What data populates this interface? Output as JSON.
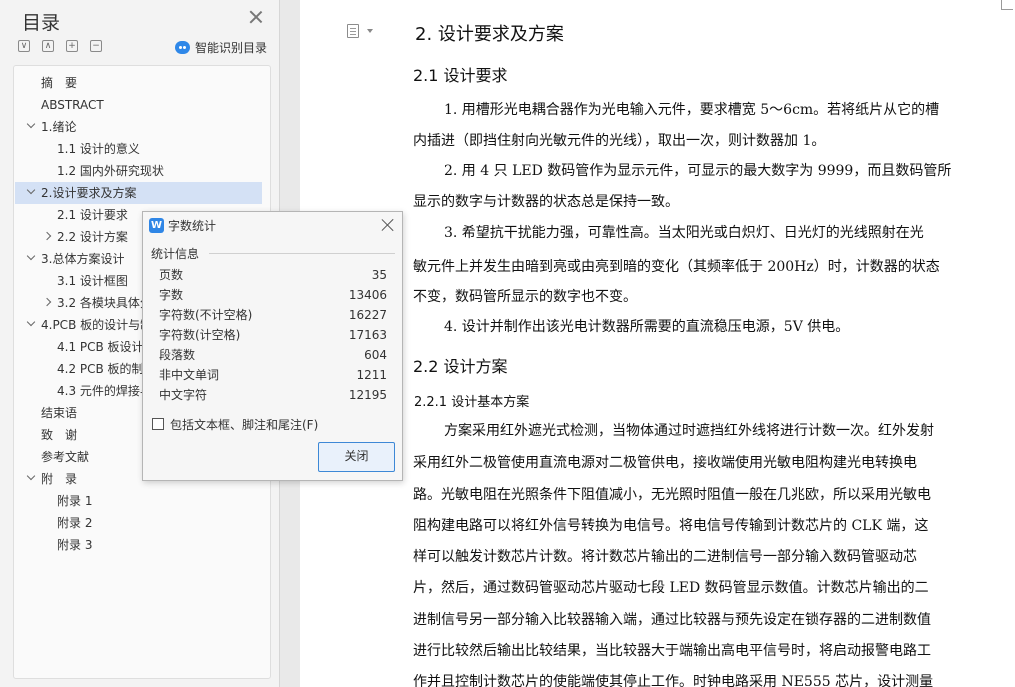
{
  "nav": {
    "title": "目录",
    "smart_toc_label": "智能识别目录",
    "items": [
      {
        "label": "摘　要",
        "level": 1,
        "caret": "none",
        "selected": false
      },
      {
        "label": "ABSTRACT",
        "level": 1,
        "caret": "none",
        "selected": false
      },
      {
        "label": "1.绪论",
        "level": 1,
        "caret": "down",
        "selected": false
      },
      {
        "label": "1.1 设计的意义",
        "level": 2,
        "caret": "none",
        "selected": false
      },
      {
        "label": "1.2 国内外研究现状",
        "level": 2,
        "caret": "none",
        "selected": false
      },
      {
        "label": "2.设计要求及方案",
        "level": 1,
        "caret": "down",
        "selected": true
      },
      {
        "label": "2.1 设计要求",
        "level": 2,
        "caret": "none",
        "selected": false
      },
      {
        "label": "2.2 设计方案",
        "level": 2,
        "caret": "right",
        "selected": false
      },
      {
        "label": "3.总体方案设计",
        "level": 1,
        "caret": "down",
        "selected": false
      },
      {
        "label": "3.1 设计框图",
        "level": 2,
        "caret": "none",
        "selected": false
      },
      {
        "label": "3.2 各模块具体分析",
        "level": 2,
        "caret": "right",
        "selected": false
      },
      {
        "label": "4.PCB 板的设计与制作",
        "level": 1,
        "caret": "down",
        "selected": false
      },
      {
        "label": "4.1 PCB 板设计",
        "level": 2,
        "caret": "none",
        "selected": false
      },
      {
        "label": "4.2 PCB 板的制作",
        "level": 2,
        "caret": "none",
        "selected": false
      },
      {
        "label": "4.3 元件的焊接与调试",
        "level": 2,
        "caret": "none",
        "selected": false
      },
      {
        "label": "结束语",
        "level": 1,
        "caret": "none",
        "selected": false
      },
      {
        "label": "致　谢",
        "level": 1,
        "caret": "none",
        "selected": false
      },
      {
        "label": "参考文献",
        "level": 1,
        "caret": "none",
        "selected": false
      },
      {
        "label": "附　录",
        "level": 1,
        "caret": "down",
        "selected": false
      },
      {
        "label": "附录 1",
        "level": 2,
        "caret": "none",
        "selected": false
      },
      {
        "label": "附录 2",
        "level": 2,
        "caret": "none",
        "selected": false
      },
      {
        "label": "附录 3",
        "level": 2,
        "caret": "none",
        "selected": false
      }
    ]
  },
  "dialog": {
    "title": "字数统计",
    "stats_heading": "统计信息",
    "stats": [
      {
        "label": "页数",
        "value": "35"
      },
      {
        "label": "字数",
        "value": "13406"
      },
      {
        "label": "字符数(不计空格)",
        "value": "16227"
      },
      {
        "label": "字符数(计空格)",
        "value": "17163"
      },
      {
        "label": "段落数",
        "value": "604"
      },
      {
        "label": "非中文单词",
        "value": "1211"
      },
      {
        "label": "中文字符",
        "value": "12195"
      }
    ],
    "include_label": "包括文本框、脚注和尾注(F)",
    "include_checked": false,
    "close_label": "关闭"
  },
  "document": {
    "lines": [
      {
        "kind": "h1",
        "text": "2.  设计要求及方案"
      },
      {
        "kind": "h2",
        "text": "2.1 设计要求"
      },
      {
        "kind": "body",
        "text": "1. 用槽形光电耦合器作为光电输入元件，要求槽宽 5～6cm。若将纸片从它的槽"
      },
      {
        "kind": "body",
        "text": "内插进（即挡住射向光敏元件的光线），取出一次，则计数器加 1。"
      },
      {
        "kind": "body",
        "text": "2. 用 4 只 LED 数码管作为显示元件，可显示的最大数字为 9999，而且数码管所"
      },
      {
        "kind": "body",
        "text": "显示的数字与计数器的状态总是保持一致。"
      },
      {
        "kind": "body",
        "text": "3. 希望抗干扰能力强，可靠性高。当太阳光或白炽灯、日光灯的光线照射在光"
      },
      {
        "kind": "body",
        "text": "敏元件上并发生由暗到亮或由亮到暗的变化（其频率低于 200Hz）时，计数器的状态"
      },
      {
        "kind": "body",
        "text": "不变，数码管所显示的数字也不变。"
      },
      {
        "kind": "body",
        "text": "4. 设计并制作出该光电计数器所需要的直流稳压电源，5V 供电。"
      },
      {
        "kind": "h2",
        "text": "2.2 设计方案"
      },
      {
        "kind": "h3",
        "text": "2.2.1 设计基本方案"
      },
      {
        "kind": "body",
        "text": "方案采用红外遮光式检测，当物体通过时遮挡红外线将进行计数一次。红外发射"
      },
      {
        "kind": "body",
        "text": "采用红外二极管使用直流电源对二极管供电，接收端使用光敏电阻构建光电转换电"
      },
      {
        "kind": "body",
        "text": "路。光敏电阻在光照条件下阻值减小，无光照时阻值一般在几兆欧，所以采用光敏电"
      },
      {
        "kind": "body",
        "text": "阻构建电路可以将红外信号转换为电信号。将电信号传输到计数芯片的 CLK 端，这"
      },
      {
        "kind": "body",
        "text": "样可以触发计数芯片计数。将计数芯片输出的二进制信号一部分输入数码管驱动芯"
      },
      {
        "kind": "body",
        "text": "片，然后，通过数码管驱动芯片驱动七段 LED 数码管显示数值。计数芯片输出的二"
      },
      {
        "kind": "body",
        "text": "进制信号另一部分输入比较器输入端，通过比较器与预先设定在锁存器的二进制数值"
      },
      {
        "kind": "body",
        "text": "进行比较然后输出比较结果，当比较器大于端输出高电平信号时，将启动报警电路工"
      },
      {
        "kind": "body",
        "text": "作并且控制计数芯片的使能端使其停止工作。时钟电路采用 NE555 芯片，设计测量"
      }
    ]
  }
}
